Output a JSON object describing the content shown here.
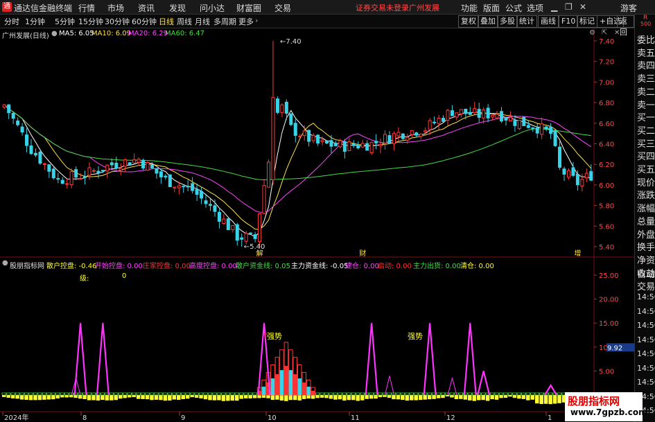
{
  "menubar": {
    "app_title": "通达信金融终端",
    "items": [
      "行情",
      "市场",
      "资讯",
      "发现",
      "问小达",
      "财富圈",
      "交易"
    ],
    "warning": "证券交易未登录",
    "stock_name": "广州发展",
    "right_items": [
      "功能",
      "版面",
      "公式",
      "选项"
    ],
    "user": "游客",
    "win_controls": [
      "▁",
      "❐",
      "✕"
    ]
  },
  "toolbar": {
    "periods": [
      "分时",
      "1分钟",
      "5分钟",
      "15分钟",
      "30分钟",
      "60分钟",
      "日线",
      "周线",
      "月线",
      "多周期",
      "更多"
    ],
    "active_period": "日线",
    "right_buttons": [
      "复权",
      "叠加",
      "多股",
      "统计",
      "画线",
      "F10",
      "标记",
      "+自选",
      "返回"
    ]
  },
  "right_side": {
    "top_label": "R",
    "top_num": "500",
    "items": [
      "委比",
      "卖五",
      "卖四",
      "卖三",
      "卖二",
      "卖一",
      "买一",
      "买二",
      "买三",
      "买四",
      "买五",
      "现价",
      "涨跌",
      "涨幅",
      "总量",
      "外盘",
      "换手",
      "净资",
      "收益"
    ],
    "lower_items": [
      "自动",
      "交易"
    ],
    "time_items": [
      "14:56",
      "14:56",
      "14:56",
      "14:56",
      "14:56",
      "14:56",
      "14:56",
      "14:56",
      "14:56"
    ]
  },
  "main_chart": {
    "title": "广州发展(日线)",
    "ma": [
      {
        "label": "MA5: 6.05",
        "color": "#ffffff"
      },
      {
        "label": "MA10: 6.09",
        "color": "#ffe14a"
      },
      {
        "label": "MA20: 6.29",
        "color": "#ff44ff"
      },
      {
        "label": "MA60: 6.47",
        "color": "#44dd44"
      }
    ],
    "y_ticks": [
      "7.40",
      "7.20",
      "7.00",
      "6.80",
      "6.60",
      "6.40",
      "6.20",
      "6.00",
      "5.80",
      "5.60",
      "5.40"
    ],
    "high_label": "7.40",
    "low_label": "5.40",
    "event_marks": [
      "解",
      "财",
      "增"
    ]
  },
  "indicator": {
    "title": "股朋指标网",
    "fields": [
      {
        "label": "散户控盘: -0.46",
        "color": "#ffff33"
      },
      {
        "label": "开始控盘: 0.00",
        "color": "#ff44ff"
      },
      {
        "label": "庄家控盘: 0.00",
        "color": "#ff3333"
      },
      {
        "label": "高度控盘: 0.00",
        "color": "#ff44ff"
      },
      {
        "label": "散户资金线: 0.05",
        "color": "#44dd44"
      },
      {
        "label": "主力资金线: -0.05",
        "color": "#ffffff"
      },
      {
        "label": "建仓: 0.00",
        "color": "#ff44ff"
      },
      {
        "label": "启动: 0.00",
        "color": "#ff3333"
      },
      {
        "label": "主力出货: 0.00",
        "color": "#44dd44"
      },
      {
        "label": "清仓: 0.00",
        "color": "#ffff33"
      }
    ],
    "level_label": "级:",
    "level_value": "0",
    "y_ticks": [
      "25.00",
      "20.00",
      "15.00",
      "10.00",
      "5.00"
    ],
    "cursor_value": "9.92",
    "annotations": [
      "强势",
      "强势"
    ]
  },
  "date_axis": [
    "2024年",
    "8",
    "9",
    "10",
    "11",
    "12",
    "1"
  ],
  "watermark": {
    "line1": "股朋指标网",
    "line2": "www.7gpzb.com"
  }
}
